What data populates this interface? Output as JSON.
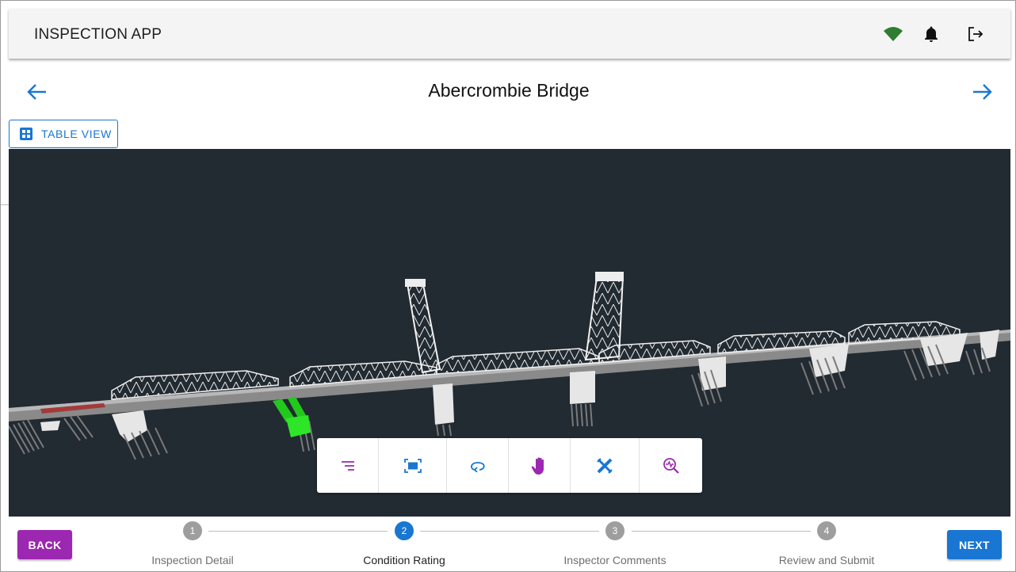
{
  "app": {
    "title": "INSPECTION APP",
    "icons": {
      "network": "wifi-icon",
      "notifications": "bell-icon",
      "logout": "logout-icon"
    },
    "colors": {
      "network": "#2e7d32",
      "primary": "#1976d2",
      "secondary": "#9c27b0",
      "viewer_bg": "#222a32"
    }
  },
  "page": {
    "title": "Abercrombie Bridge",
    "prev_icon": "arrow-left-icon",
    "next_icon": "arrow-right-icon",
    "table_view_label": "TABLE VIEW",
    "table_view_icon": "grid-icon"
  },
  "viewer": {
    "toolbar": [
      {
        "name": "model-browser",
        "icon": "tree-list-icon"
      },
      {
        "name": "fit-to-view",
        "icon": "fit-view-icon"
      },
      {
        "name": "orbit",
        "icon": "orbit-icon"
      },
      {
        "name": "pan",
        "icon": "hand-icon"
      },
      {
        "name": "measure",
        "icon": "measure-icon"
      },
      {
        "name": "inspect",
        "icon": "inspect-zoom-icon"
      }
    ]
  },
  "footer": {
    "back_label": "BACK",
    "next_label": "NEXT",
    "steps": [
      {
        "number": "1",
        "label": "Inspection Detail",
        "active": false
      },
      {
        "number": "2",
        "label": "Condition Rating",
        "active": true
      },
      {
        "number": "3",
        "label": "Inspector Comments",
        "active": false
      },
      {
        "number": "4",
        "label": "Review and Submit",
        "active": false
      }
    ]
  }
}
